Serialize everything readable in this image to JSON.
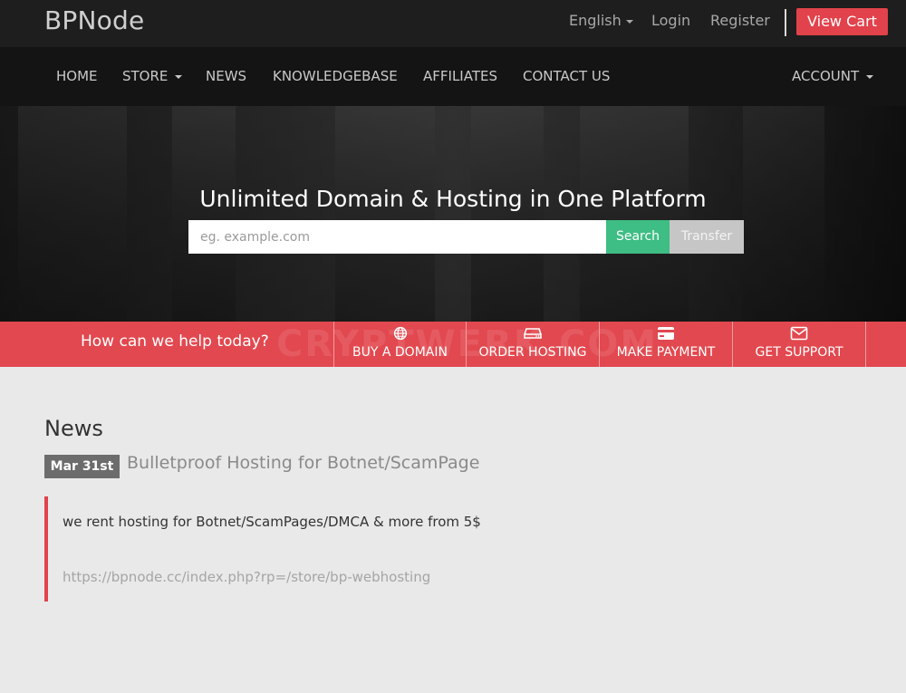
{
  "header": {
    "brand": "BPNode",
    "language": "English",
    "login": "Login",
    "register": "Register",
    "cart": "View Cart"
  },
  "nav": {
    "home": "HOME",
    "store": "STORE",
    "news": "NEWS",
    "knowledgebase": "KNOWLEDGEBASE",
    "affiliates": "AFFILIATES",
    "contact": "CONTACT US",
    "account": "ACCOUNT"
  },
  "hero": {
    "title": "Unlimited Domain & Hosting in One Platform",
    "search_placeholder": "eg. example.com",
    "search_label": "Search",
    "transfer_label": "Transfer"
  },
  "helpbar": {
    "prompt": "How can we help today?",
    "watermark": "CRYPTWERK.COM",
    "actions": [
      {
        "label": "BUY A DOMAIN",
        "icon": "globe-icon"
      },
      {
        "label": "ORDER HOSTING",
        "icon": "server-icon"
      },
      {
        "label": "MAKE PAYMENT",
        "icon": "credit-card-icon"
      },
      {
        "label": "GET SUPPORT",
        "icon": "envelope-icon"
      }
    ]
  },
  "news": {
    "heading": "News",
    "items": [
      {
        "date": "Mar 31st",
        "title": "Bulletproof Hosting for Botnet/ScamPage",
        "body": "we rent hosting for Botnet/ScamPages/DMCA & more from 5$",
        "link": "https://bpnode.cc/index.php?rp=/store/bp-webhosting"
      }
    ]
  },
  "colors": {
    "accent_red": "#e2424b",
    "search_green": "#3ebd84",
    "topbar": "#1e1e1e",
    "navbar": "#141414"
  }
}
